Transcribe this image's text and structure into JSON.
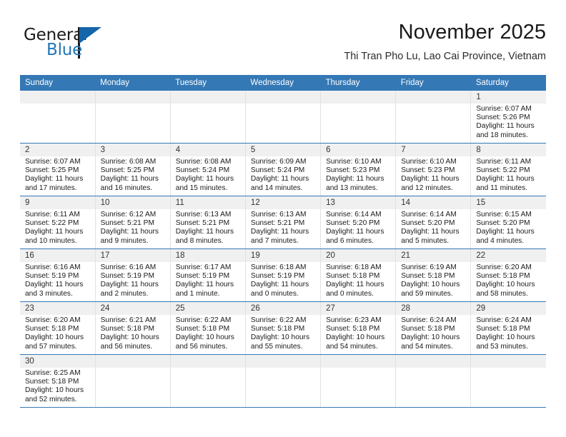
{
  "brand": {
    "name_top": "General",
    "name_bottom": "Blue",
    "accent_color": "#2077b8"
  },
  "header": {
    "title": "November 2025",
    "location": "Thi Tran Pho Lu, Lao Cai Province, Vietnam"
  },
  "calendar": {
    "header_bg": "#3478b5",
    "daynum_bg": "#f0f0f0",
    "weekdays": [
      "Sunday",
      "Monday",
      "Tuesday",
      "Wednesday",
      "Thursday",
      "Friday",
      "Saturday"
    ],
    "weeks": [
      [
        {
          "day": "",
          "blank": true,
          "lines": [
            "",
            "",
            "",
            ""
          ]
        },
        {
          "day": "",
          "blank": true,
          "lines": [
            "",
            "",
            "",
            ""
          ]
        },
        {
          "day": "",
          "blank": true,
          "lines": [
            "",
            "",
            "",
            ""
          ]
        },
        {
          "day": "",
          "blank": true,
          "lines": [
            "",
            "",
            "",
            ""
          ]
        },
        {
          "day": "",
          "blank": true,
          "lines": [
            "",
            "",
            "",
            ""
          ]
        },
        {
          "day": "",
          "blank": true,
          "lines": [
            "",
            "",
            "",
            ""
          ]
        },
        {
          "day": "1",
          "blank": false,
          "lines": [
            "Sunrise: 6:07 AM",
            "Sunset: 5:26 PM",
            "Daylight: 11 hours",
            "and 18 minutes."
          ]
        }
      ],
      [
        {
          "day": "2",
          "blank": false,
          "lines": [
            "Sunrise: 6:07 AM",
            "Sunset: 5:25 PM",
            "Daylight: 11 hours",
            "and 17 minutes."
          ]
        },
        {
          "day": "3",
          "blank": false,
          "lines": [
            "Sunrise: 6:08 AM",
            "Sunset: 5:25 PM",
            "Daylight: 11 hours",
            "and 16 minutes."
          ]
        },
        {
          "day": "4",
          "blank": false,
          "lines": [
            "Sunrise: 6:08 AM",
            "Sunset: 5:24 PM",
            "Daylight: 11 hours",
            "and 15 minutes."
          ]
        },
        {
          "day": "5",
          "blank": false,
          "lines": [
            "Sunrise: 6:09 AM",
            "Sunset: 5:24 PM",
            "Daylight: 11 hours",
            "and 14 minutes."
          ]
        },
        {
          "day": "6",
          "blank": false,
          "lines": [
            "Sunrise: 6:10 AM",
            "Sunset: 5:23 PM",
            "Daylight: 11 hours",
            "and 13 minutes."
          ]
        },
        {
          "day": "7",
          "blank": false,
          "lines": [
            "Sunrise: 6:10 AM",
            "Sunset: 5:23 PM",
            "Daylight: 11 hours",
            "and 12 minutes."
          ]
        },
        {
          "day": "8",
          "blank": false,
          "lines": [
            "Sunrise: 6:11 AM",
            "Sunset: 5:22 PM",
            "Daylight: 11 hours",
            "and 11 minutes."
          ]
        }
      ],
      [
        {
          "day": "9",
          "blank": false,
          "lines": [
            "Sunrise: 6:11 AM",
            "Sunset: 5:22 PM",
            "Daylight: 11 hours",
            "and 10 minutes."
          ]
        },
        {
          "day": "10",
          "blank": false,
          "lines": [
            "Sunrise: 6:12 AM",
            "Sunset: 5:21 PM",
            "Daylight: 11 hours",
            "and 9 minutes."
          ]
        },
        {
          "day": "11",
          "blank": false,
          "lines": [
            "Sunrise: 6:13 AM",
            "Sunset: 5:21 PM",
            "Daylight: 11 hours",
            "and 8 minutes."
          ]
        },
        {
          "day": "12",
          "blank": false,
          "lines": [
            "Sunrise: 6:13 AM",
            "Sunset: 5:21 PM",
            "Daylight: 11 hours",
            "and 7 minutes."
          ]
        },
        {
          "day": "13",
          "blank": false,
          "lines": [
            "Sunrise: 6:14 AM",
            "Sunset: 5:20 PM",
            "Daylight: 11 hours",
            "and 6 minutes."
          ]
        },
        {
          "day": "14",
          "blank": false,
          "lines": [
            "Sunrise: 6:14 AM",
            "Sunset: 5:20 PM",
            "Daylight: 11 hours",
            "and 5 minutes."
          ]
        },
        {
          "day": "15",
          "blank": false,
          "lines": [
            "Sunrise: 6:15 AM",
            "Sunset: 5:20 PM",
            "Daylight: 11 hours",
            "and 4 minutes."
          ]
        }
      ],
      [
        {
          "day": "16",
          "blank": false,
          "lines": [
            "Sunrise: 6:16 AM",
            "Sunset: 5:19 PM",
            "Daylight: 11 hours",
            "and 3 minutes."
          ]
        },
        {
          "day": "17",
          "blank": false,
          "lines": [
            "Sunrise: 6:16 AM",
            "Sunset: 5:19 PM",
            "Daylight: 11 hours",
            "and 2 minutes."
          ]
        },
        {
          "day": "18",
          "blank": false,
          "lines": [
            "Sunrise: 6:17 AM",
            "Sunset: 5:19 PM",
            "Daylight: 11 hours",
            "and 1 minute."
          ]
        },
        {
          "day": "19",
          "blank": false,
          "lines": [
            "Sunrise: 6:18 AM",
            "Sunset: 5:19 PM",
            "Daylight: 11 hours",
            "and 0 minutes."
          ]
        },
        {
          "day": "20",
          "blank": false,
          "lines": [
            "Sunrise: 6:18 AM",
            "Sunset: 5:18 PM",
            "Daylight: 11 hours",
            "and 0 minutes."
          ]
        },
        {
          "day": "21",
          "blank": false,
          "lines": [
            "Sunrise: 6:19 AM",
            "Sunset: 5:18 PM",
            "Daylight: 10 hours",
            "and 59 minutes."
          ]
        },
        {
          "day": "22",
          "blank": false,
          "lines": [
            "Sunrise: 6:20 AM",
            "Sunset: 5:18 PM",
            "Daylight: 10 hours",
            "and 58 minutes."
          ]
        }
      ],
      [
        {
          "day": "23",
          "blank": false,
          "lines": [
            "Sunrise: 6:20 AM",
            "Sunset: 5:18 PM",
            "Daylight: 10 hours",
            "and 57 minutes."
          ]
        },
        {
          "day": "24",
          "blank": false,
          "lines": [
            "Sunrise: 6:21 AM",
            "Sunset: 5:18 PM",
            "Daylight: 10 hours",
            "and 56 minutes."
          ]
        },
        {
          "day": "25",
          "blank": false,
          "lines": [
            "Sunrise: 6:22 AM",
            "Sunset: 5:18 PM",
            "Daylight: 10 hours",
            "and 56 minutes."
          ]
        },
        {
          "day": "26",
          "blank": false,
          "lines": [
            "Sunrise: 6:22 AM",
            "Sunset: 5:18 PM",
            "Daylight: 10 hours",
            "and 55 minutes."
          ]
        },
        {
          "day": "27",
          "blank": false,
          "lines": [
            "Sunrise: 6:23 AM",
            "Sunset: 5:18 PM",
            "Daylight: 10 hours",
            "and 54 minutes."
          ]
        },
        {
          "day": "28",
          "blank": false,
          "lines": [
            "Sunrise: 6:24 AM",
            "Sunset: 5:18 PM",
            "Daylight: 10 hours",
            "and 54 minutes."
          ]
        },
        {
          "day": "29",
          "blank": false,
          "lines": [
            "Sunrise: 6:24 AM",
            "Sunset: 5:18 PM",
            "Daylight: 10 hours",
            "and 53 minutes."
          ]
        }
      ],
      [
        {
          "day": "30",
          "blank": false,
          "lines": [
            "Sunrise: 6:25 AM",
            "Sunset: 5:18 PM",
            "Daylight: 10 hours",
            "and 52 minutes."
          ]
        },
        {
          "day": "",
          "blank": true,
          "lines": [
            "",
            "",
            "",
            ""
          ]
        },
        {
          "day": "",
          "blank": true,
          "lines": [
            "",
            "",
            "",
            ""
          ]
        },
        {
          "day": "",
          "blank": true,
          "lines": [
            "",
            "",
            "",
            ""
          ]
        },
        {
          "day": "",
          "blank": true,
          "lines": [
            "",
            "",
            "",
            ""
          ]
        },
        {
          "day": "",
          "blank": true,
          "lines": [
            "",
            "",
            "",
            ""
          ]
        },
        {
          "day": "",
          "blank": true,
          "lines": [
            "",
            "",
            "",
            ""
          ]
        }
      ]
    ]
  }
}
